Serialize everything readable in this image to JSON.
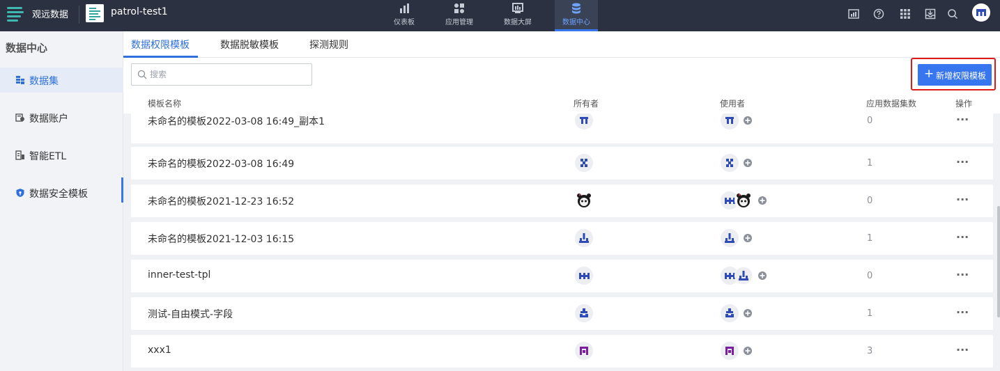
{
  "header": {
    "brand": "观远数据",
    "project": "patrol-test1",
    "nav": [
      {
        "label": "仪表板",
        "icon": "bar-chart-icon"
      },
      {
        "label": "应用管理",
        "icon": "apps-icon"
      },
      {
        "label": "数据大屏",
        "icon": "screen-icon"
      },
      {
        "label": "数据中心",
        "icon": "database-icon",
        "active": true
      }
    ],
    "right_icons": [
      "dashboard-icon",
      "help-icon",
      "grid-icon",
      "inbox-icon",
      "search-icon",
      "user-avatar"
    ]
  },
  "sidebar": {
    "title": "数据中心",
    "items": [
      {
        "label": "数据集",
        "icon": "dataset-icon",
        "active": true
      },
      {
        "label": "数据账户",
        "icon": "account-icon"
      },
      {
        "label": "智能ETL",
        "icon": "etl-icon"
      },
      {
        "label": "数据安全模板",
        "icon": "shield-icon"
      }
    ]
  },
  "tabs": [
    {
      "label": "数据权限模板",
      "active": true
    },
    {
      "label": "数据脱敏模板"
    },
    {
      "label": "探测规则"
    }
  ],
  "toolbar": {
    "search_placeholder": "搜索",
    "add_label": "新增权限模板"
  },
  "table": {
    "columns": [
      "模板名称",
      "所有者",
      "使用者",
      "应用数据集数",
      "操作"
    ],
    "rows": [
      {
        "name": "未命名的模板2022-03-08 16:49_副本1",
        "owner": "avatar-tt",
        "users": [
          "avatar-tt"
        ],
        "count": "0"
      },
      {
        "name": "未命名的模板2022-03-08 16:49",
        "owner": "avatar-blocks",
        "users": [
          "avatar-blocks"
        ],
        "count": "1"
      },
      {
        "name": "未命名的模板2021-12-23 16:52",
        "owner": "avatar-panda",
        "users": [
          "avatar-m",
          "avatar-panda"
        ],
        "count": "0"
      },
      {
        "name": "未命名的模板2021-12-03 16:15",
        "owner": "avatar-stack",
        "users": [
          "avatar-stack"
        ],
        "count": "1"
      },
      {
        "name": "inner-test-tpl",
        "owner": "avatar-m",
        "users": [
          "avatar-m",
          "avatar-stack"
        ],
        "count": "0"
      },
      {
        "name": "测试-自由模式-字段",
        "owner": "avatar-pyramid",
        "users": [
          "avatar-pyramid"
        ],
        "count": "1"
      },
      {
        "name": "xxx1",
        "owner": "avatar-purple",
        "users": [
          "avatar-purple"
        ],
        "count": "3"
      }
    ],
    "ops_label": "···"
  },
  "colors": {
    "topbar": "#2b3140",
    "accent": "#3876f0",
    "highlight_frame": "#e0191b"
  }
}
